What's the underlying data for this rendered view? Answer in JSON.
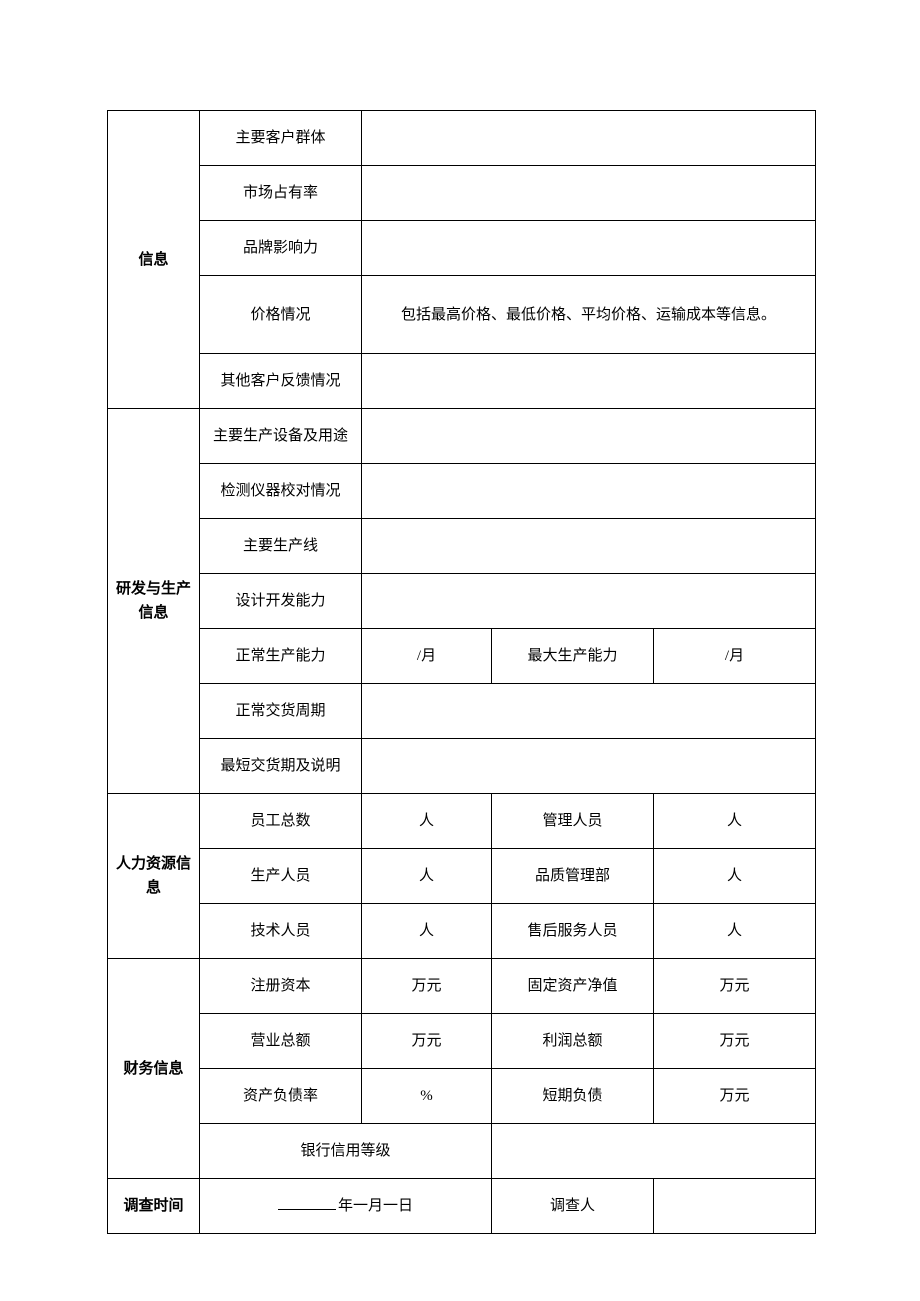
{
  "sections": {
    "info": "信息",
    "rnd": "研发与生产信息",
    "hr": "人力资源信息",
    "fin": "财务信息"
  },
  "info": {
    "main_customers": "主要客户群体",
    "main_customers_val": "",
    "market_share": "市场占有率",
    "market_share_val": "",
    "brand_influence": "品牌影响力",
    "brand_influence_val": "",
    "price_status": "价格情况",
    "price_status_val": "包括最高价格、最低价格、平均价格、运输成本等信息。",
    "other_feedback": "其他客户反馈情况",
    "other_feedback_val": ""
  },
  "rnd": {
    "equipment": "主要生产设备及用途",
    "equipment_val": "",
    "inspection": "检测仪器校对情况",
    "inspection_val": "",
    "lines": "主要生产线",
    "lines_val": "",
    "design": "设计开发能力",
    "design_val": "",
    "normal_capacity": "正常生产能力",
    "normal_capacity_unit": "/月",
    "max_capacity": "最大生产能力",
    "max_capacity_unit": "/月",
    "lead_time": "正常交货周期",
    "lead_time_val": "",
    "shortest_lead": "最短交货期及说明",
    "shortest_lead_val": ""
  },
  "hr": {
    "total": "员工总数",
    "total_unit": "人",
    "mgmt": "管理人员",
    "mgmt_unit": "人",
    "prod": "生产人员",
    "prod_unit": "人",
    "qc": "品质管理部",
    "qc_unit": "人",
    "tech": "技术人员",
    "tech_unit": "人",
    "after": "售后服务人员",
    "after_unit": "人"
  },
  "fin": {
    "reg_capital": "注册资本",
    "reg_capital_unit": "万元",
    "fixed_assets": "固定资产净值",
    "fixed_assets_unit": "万元",
    "turnover": "营业总额",
    "turnover_unit": "万元",
    "profit": "利润总额",
    "profit_unit": "万元",
    "debt_ratio": "资产负债率",
    "debt_ratio_unit": "%",
    "short_debt": "短期负债",
    "short_debt_unit": "万元",
    "bank_rating": "银行信用等级",
    "bank_rating_val": ""
  },
  "footer": {
    "survey_time": "调查时间",
    "survey_time_val": "年一月一日",
    "surveyor": "调查人",
    "surveyor_val": ""
  }
}
